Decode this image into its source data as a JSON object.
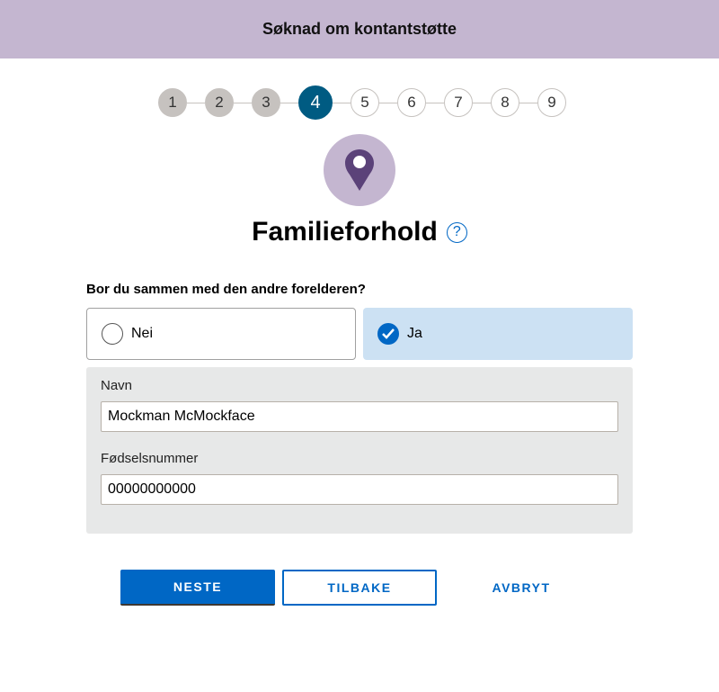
{
  "header": {
    "title": "Søknad om kontantstøtte"
  },
  "stepper": {
    "steps": [
      "1",
      "2",
      "3",
      "4",
      "5",
      "6",
      "7",
      "8",
      "9"
    ],
    "current": 4
  },
  "page": {
    "title": "Familieforhold",
    "help_icon": "?",
    "icon": "location-pin-icon"
  },
  "question": {
    "label": "Bor du sammen med den andre forelderen?",
    "options": [
      {
        "label": "Nei",
        "selected": false
      },
      {
        "label": "Ja",
        "selected": true
      }
    ]
  },
  "form": {
    "name_label": "Navn",
    "name_value": "Mockman McMockface",
    "fnr_label": "Fødselsnummer",
    "fnr_value": "00000000000"
  },
  "buttons": {
    "next": "NESTE",
    "back": "TILBAKE",
    "cancel": "AVBRYT"
  },
  "colors": {
    "header": "#c4b6d0",
    "active_step": "#005b82",
    "primary": "#0067c5",
    "selected_option": "#cce1f3"
  }
}
